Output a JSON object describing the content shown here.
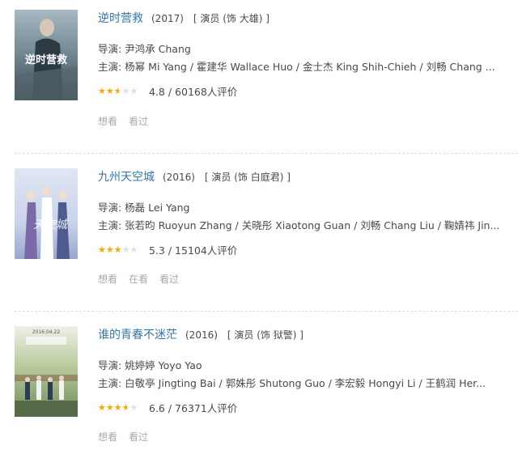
{
  "items": [
    {
      "title": "逆时营救",
      "year": "(2017)",
      "role": "[ 演员 (饰 大雄) ]",
      "director": "导演: 尹鸿承 Chang",
      "cast": "主演: 杨幂 Mi Yang / 霍建华 Wallace Huo / 金士杰 King Shih-Chieh / 刘畅 Chang ...",
      "rating_value": 4.8,
      "rating_text": "4.8 / 60168人评价",
      "actions": [
        "想看",
        "看过"
      ]
    },
    {
      "title": "九州天空城",
      "year": "(2016)",
      "role": "[ 演员 (饰 白庭君) ]",
      "director": "导演: 杨磊 Lei Yang",
      "cast": "主演: 张若昀 Ruoyun Zhang / 关晓彤 Xiaotong Guan / 刘畅 Chang Liu / 鞠婧祎 Jin...",
      "rating_value": 5.3,
      "rating_text": "5.3 / 15104人评价",
      "actions": [
        "想看",
        "在看",
        "看过"
      ]
    },
    {
      "title": "谁的青春不迷茫",
      "year": "(2016)",
      "role": "[ 演员 (饰 狱警) ]",
      "director": "导演: 姚婷婷 Yoyo Yao",
      "cast": "主演: 白敬亭 Jingting Bai / 郭姝彤 Shutong Guo / 李宏毅 Hongyi Li / 王鹤润 Her...",
      "rating_value": 6.6,
      "rating_text": "6.6 / 76371人评价",
      "actions": [
        "想看",
        "看过"
      ]
    }
  ],
  "poster_text": [
    "逆时营救",
    "天空城",
    "2016.04.22"
  ],
  "colors": {
    "link": "#3377aa",
    "star": "#f6ac00",
    "muted": "#aaaaaa"
  }
}
